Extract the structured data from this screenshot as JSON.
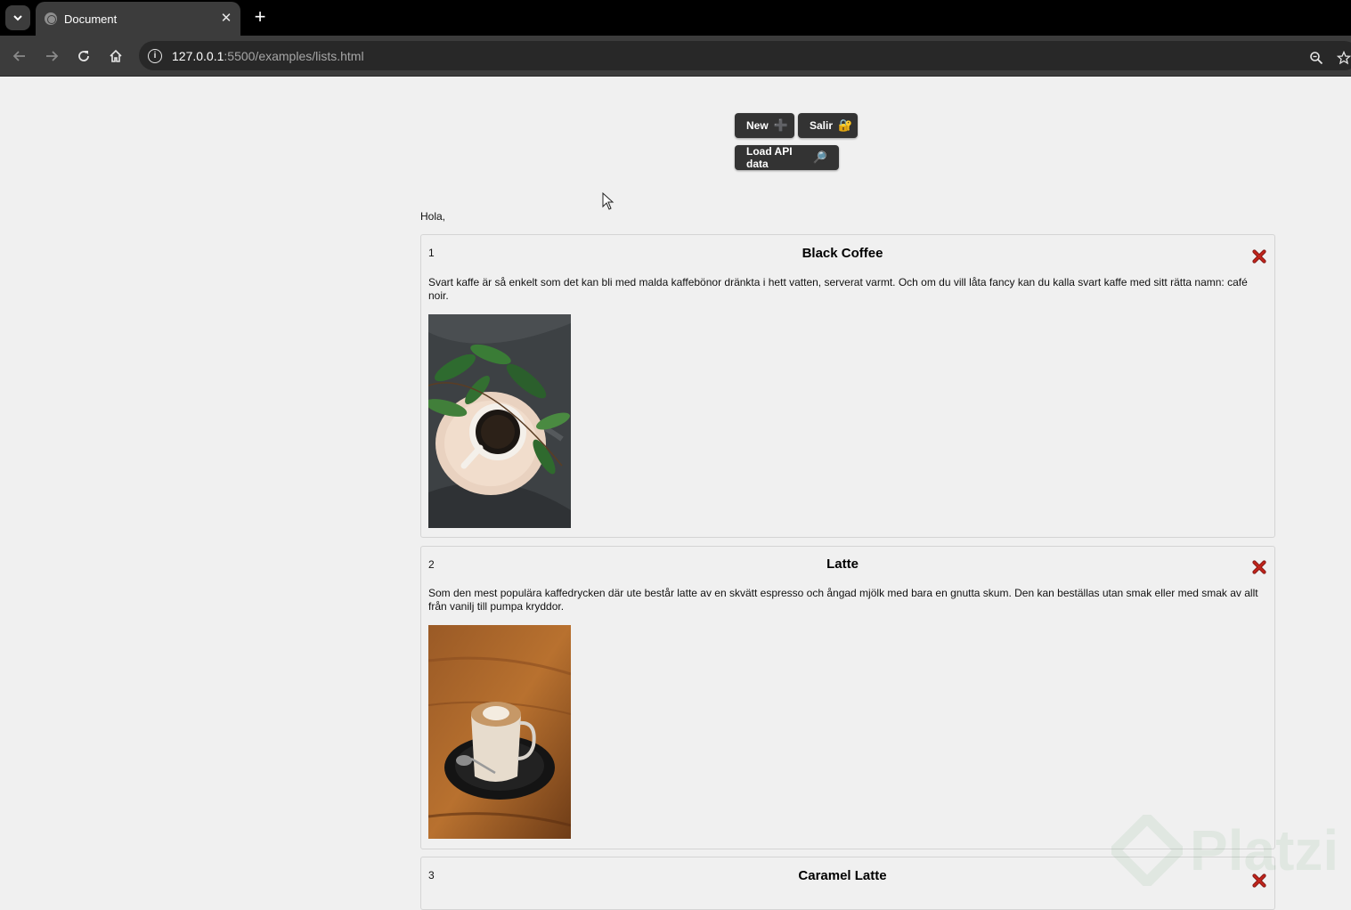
{
  "browser": {
    "tab_title": "Document",
    "tab_close": "✕",
    "new_tab": "+",
    "url_host": "127.0.0.1",
    "url_rest": ":5500/examples/lists.html"
  },
  "toolbar": {
    "new_label": "New",
    "new_icon": "➕",
    "salir_label": "Salir",
    "salir_icon": "🔐",
    "load_label": "Load API data",
    "load_icon": "🔎"
  },
  "greeting": "Hola,",
  "items": [
    {
      "id": "1",
      "name": "Black Coffee",
      "description": "Svart kaffe är så enkelt som det kan bli med malda kaffebönor dränkta i hett vatten, serverat varmt. Och om du vill låta fancy kan du kalla svart kaffe med sitt rätta namn: café noir.",
      "image": "black-coffee-cup-on-tray-with-leaves"
    },
    {
      "id": "2",
      "name": "Latte",
      "description": "Som den mest populära kaffedrycken där ute består latte av en skvätt espresso och ångad mjölk med bara en gnutta skum. Den kan beställas utan smak eller med smak av allt från vanilj till pumpa kryddor.",
      "image": "latte-glass-on-black-saucer"
    },
    {
      "id": "3",
      "name": "Caramel Latte",
      "description": "",
      "image": ""
    }
  ],
  "watermark": "Platzi",
  "colors": {
    "button_bg": "#333333",
    "page_bg": "#f0f0f0",
    "delete_red": "#c0241c",
    "chrome_dark": "#3c3c3c"
  }
}
